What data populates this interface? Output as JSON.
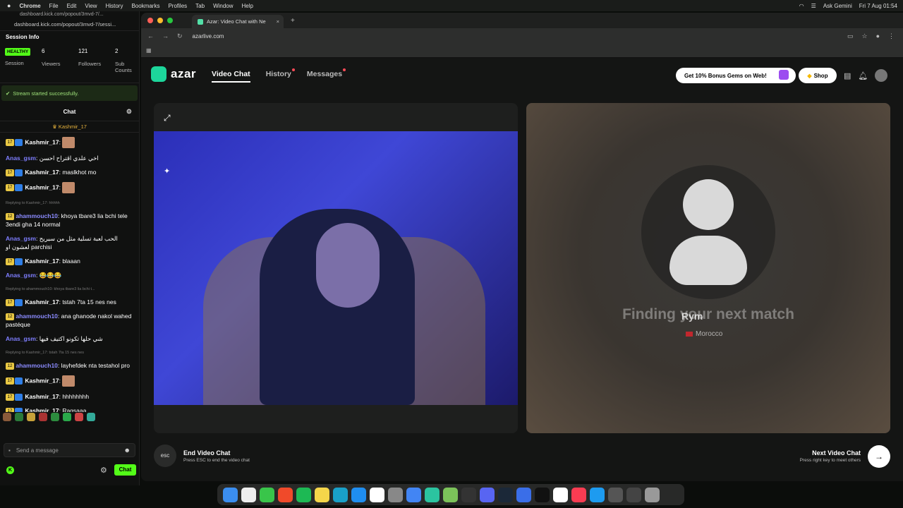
{
  "menubar": {
    "app": "Chrome",
    "items": [
      "File",
      "Edit",
      "View",
      "History",
      "Bookmarks",
      "Profiles",
      "Tab",
      "Window",
      "Help"
    ],
    "ask": "Ask Gemini",
    "datetime": "Fri 7 Aug  01:54"
  },
  "left_panel": {
    "url_top": "dashboard.kick.com/popout/3mvd-7/...",
    "url": "dashboard.kick.com/popout/3mvd-7/sessi...",
    "title": "Session Info",
    "health": "HEALTHY",
    "stats": [
      {
        "value": "",
        "label": "Session"
      },
      {
        "value": "6",
        "label": "Viewers"
      },
      {
        "value": "121",
        "label": "Followers"
      },
      {
        "value": "2",
        "label": "Sub Counts"
      }
    ],
    "stream_status": "Stream started successfully.",
    "chat_title": "Chat",
    "pinned_user": "Kashmir_17",
    "messages": [
      {
        "user": "Kashmir_17",
        "text": "",
        "badges": true,
        "emote": true
      },
      {
        "user": "Anas_gsm",
        "text": "اخي علدي اقتراح احسن",
        "badges": false
      },
      {
        "user": "Kashmir_17",
        "text": "maslkhot mo",
        "badges": true
      },
      {
        "user": "Kashmir_17",
        "text": "",
        "badges": true,
        "emote": true
      },
      {
        "reply": "Replying to Kashmir_17: hhhhh",
        "user": "ahammouch10",
        "text": "khoya tbare3 lia bchi tele 3endi gha 14 normal",
        "badges": "sub"
      },
      {
        "user": "Anas_gsm",
        "text": "الحب لعبة تسلية مثل من سيريح لعشون او parchisi",
        "badges": false
      },
      {
        "user": "Kashmir_17",
        "text": "blaaan",
        "badges": true
      },
      {
        "user": "Anas_gsm",
        "text": "😂😂😂",
        "badges": false
      },
      {
        "reply": "Replying to ahammouch10: khoya tbare3 lia bchi t...",
        "user": "Kashmir_17",
        "text": "tstah 7ta 15 nes nes",
        "badges": true
      },
      {
        "user": "ahammouch10",
        "text": "ana ghanode nakol wahed pastéque",
        "badges": "sub"
      },
      {
        "user": "Anas_gsm",
        "text": "شي حلها تكونو اكتيف فيها",
        "badges": false
      },
      {
        "reply": "Replying to Kashmir_17: tstah 7ta 15 nes nes",
        "user": "ahammouch10",
        "text": "layhefdek nta testahol pro",
        "badges": "sub"
      },
      {
        "user": "Kashmir_17",
        "text": "",
        "badges": true,
        "emote": true
      },
      {
        "user": "Kashmir_17",
        "text": "hhhhhhhh",
        "badges": true
      },
      {
        "user": "Kashmir_17",
        "text": "Ragsaaa",
        "badges": true
      }
    ],
    "send_placeholder": "Send a message",
    "chat_button": "Chat"
  },
  "browser": {
    "tab_title": "Azar: Video Chat with Ne",
    "url": "azarlive.com"
  },
  "azar": {
    "logo": "azar",
    "nav": [
      {
        "label": "Video Chat",
        "active": true,
        "dot": false
      },
      {
        "label": "History",
        "active": false,
        "dot": true
      },
      {
        "label": "Messages",
        "active": false,
        "dot": true
      }
    ],
    "promo": "Get 10% Bonus Gems on Web!",
    "shop": "Shop",
    "finding": "Finding your next match",
    "match_name": "Rym",
    "match_country": "Morocco",
    "esc": "esc",
    "end_title": "End Video Chat",
    "end_sub": "Press ESC to end the video chat",
    "next_title": "Next Video Chat",
    "next_sub": "Press right key to meet others",
    "accent": "#1dd69b"
  }
}
